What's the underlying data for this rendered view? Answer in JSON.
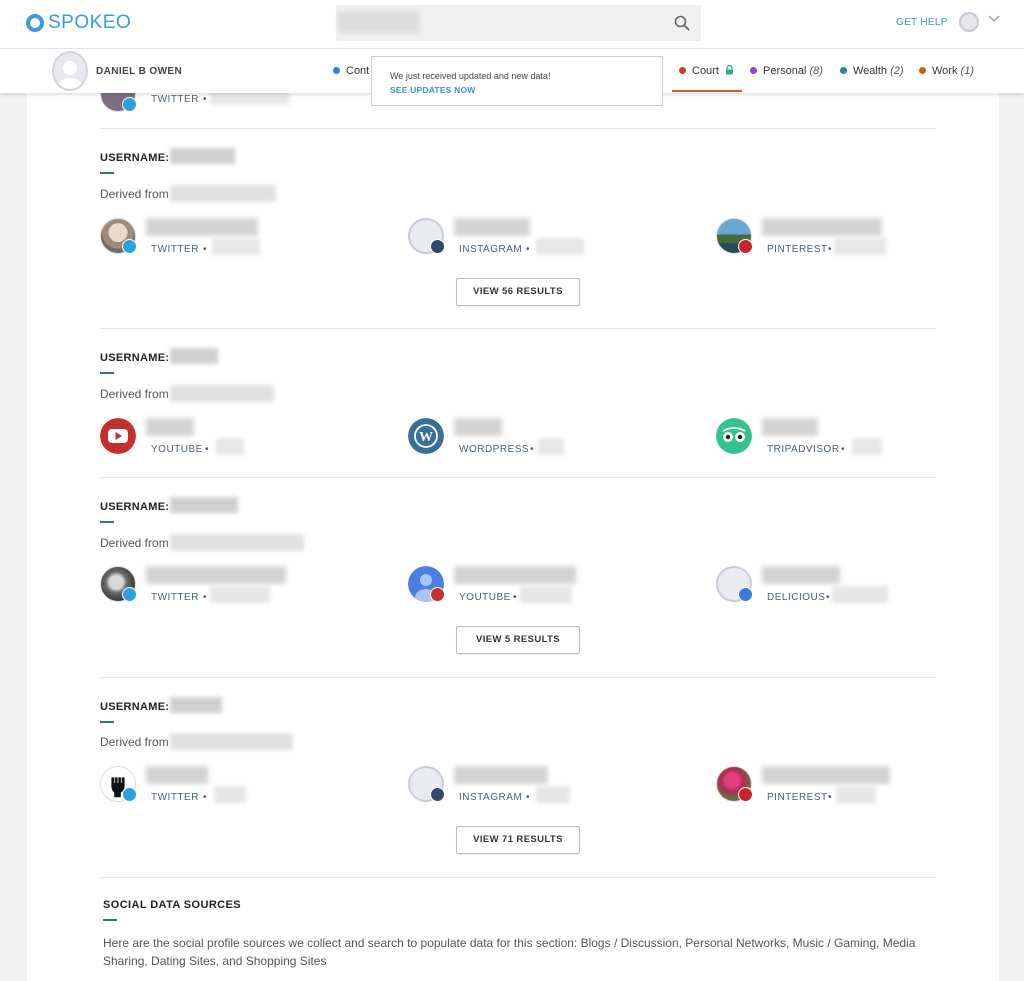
{
  "header": {
    "logo_text": "SPOKEO",
    "get_help": "GET HELP"
  },
  "subnav": {
    "person_name": "DANIEL B OWEN",
    "tabs": [
      {
        "label": "Cont",
        "color": "#2f86c8",
        "count": ""
      },
      {
        "label": "Court",
        "color": "#c9401b",
        "count": ""
      },
      {
        "label": "Personal",
        "color": "#8e44c4",
        "count": "(8)"
      },
      {
        "label": "Wealth",
        "color": "#238a87",
        "count": "(2)"
      },
      {
        "label": "Work",
        "color": "#c8621b",
        "count": "(1)"
      }
    ]
  },
  "popup": {
    "message": "We just received updated and new data!",
    "link": "SEE UPDATES NOW"
  },
  "top_partial": {
    "network": "TWITTER"
  },
  "groups": [
    {
      "username_label": "USERNAME:",
      "derived_label": "Derived from",
      "profiles": [
        {
          "network": "TWITTER",
          "avatar": "photo-avatar",
          "badge": "twitter-badge-icon"
        },
        {
          "network": "INSTAGRAM",
          "avatar": "default-avatar",
          "badge": "instagram-badge-icon"
        },
        {
          "network": "PINTEREST",
          "avatar": "photo-avatar",
          "badge": "pinterest-badge-icon"
        }
      ],
      "button": "VIEW 56 RESULTS"
    },
    {
      "username_label": "USERNAME:",
      "derived_label": "Derived from",
      "profiles": [
        {
          "network": "YOUTUBE",
          "avatar": "youtube-logo-icon",
          "badge": ""
        },
        {
          "network": "WORDPRESS",
          "avatar": "wordpress-logo-icon",
          "badge": ""
        },
        {
          "network": "TRIPADVISOR",
          "avatar": "tripadvisor-logo-icon",
          "badge": ""
        }
      ],
      "button": ""
    },
    {
      "username_label": "USERNAME:",
      "derived_label": "Derived from",
      "profiles": [
        {
          "network": "TWITTER",
          "avatar": "photo-avatar",
          "badge": "twitter-badge-icon"
        },
        {
          "network": "YOUTUBE",
          "avatar": "default-person-avatar",
          "badge": "youtube-badge-icon"
        },
        {
          "network": "DELICIOUS",
          "avatar": "default-avatar",
          "badge": "delicious-badge-icon"
        }
      ],
      "button": "VIEW 5 RESULTS"
    },
    {
      "username_label": "USERNAME:",
      "derived_label": "Derived from",
      "profiles": [
        {
          "network": "TWITTER",
          "avatar": "fist-avatar",
          "badge": "twitter-badge-icon"
        },
        {
          "network": "INSTAGRAM",
          "avatar": "default-avatar",
          "badge": "instagram-badge-icon"
        },
        {
          "network": "PINTEREST",
          "avatar": "photo-avatar",
          "badge": "pinterest-badge-icon"
        }
      ],
      "button": "VIEW 71 RESULTS"
    }
  ],
  "social_sources": {
    "title": "SOCIAL DATA SOURCES",
    "text": "Here are the social profile sources we collect and search to populate data for this section: Blogs / Discussion, Personal Networks, Music / Gaming, Media Sharing, Dating Sites, and Shopping Sites"
  },
  "colors": {
    "brand_blue": "#3b9be0",
    "twitter": "#2da1e0",
    "instagram": "#2f4a6e",
    "pinterest": "#c8232c",
    "youtube": "#c4302b",
    "wordpress": "#3a6f98",
    "tripadvisor": "#34c28f",
    "delicious": "#3a7bd5"
  }
}
